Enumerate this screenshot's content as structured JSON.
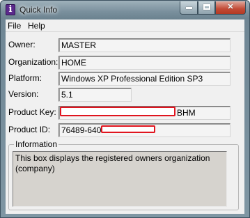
{
  "window": {
    "title": "Quick Info",
    "close_glyph": "✕"
  },
  "menu": {
    "items": [
      "File",
      "Help"
    ]
  },
  "fields": [
    {
      "label": "Owner:",
      "value": "MASTER"
    },
    {
      "label": "Organization:",
      "value": "HOME"
    },
    {
      "label": "Platform:",
      "value": "Windows XP Professional Edition SP3"
    },
    {
      "label": "Version:",
      "value": "5.1"
    },
    {
      "label": "Product Key:",
      "value": "BHM"
    },
    {
      "label": "Product ID:",
      "value": "76489-640-"
    }
  ],
  "information": {
    "title": "Information",
    "text": "This box displays the registered owners organization (company)"
  },
  "colors": {
    "redaction": "#e0141e",
    "info_background": "#d6d3ce",
    "app_icon": "#5b2a8c"
  }
}
